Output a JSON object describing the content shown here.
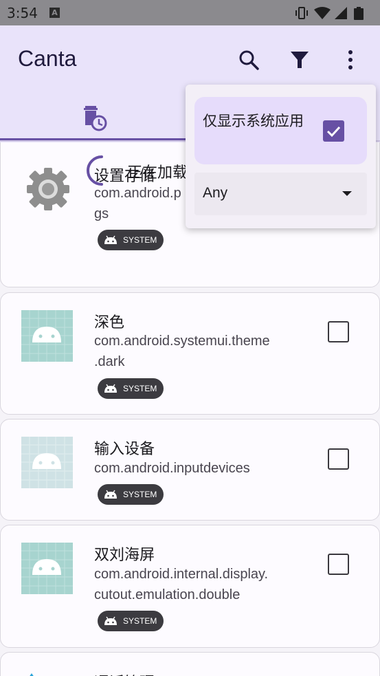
{
  "status_bar": {
    "time": "3:54",
    "notification_letter": "A",
    "icons": [
      "vibrate-icon",
      "wifi-icon",
      "signal-icon",
      "battery-icon"
    ]
  },
  "app_bar": {
    "title": "Canta",
    "actions": [
      "search-icon",
      "filter-icon",
      "more-vert-icon"
    ]
  },
  "tabs": [
    {
      "icon": "delete-schedule-icon",
      "selected": true
    }
  ],
  "loading": {
    "text": "正在加载"
  },
  "apps": [
    {
      "name": "设置存储",
      "package": "com.android.settings",
      "package_visible": "com.android.p\ngs",
      "badge": "SYSTEM",
      "icon": "settings-gear-icon",
      "checked": false
    },
    {
      "name": "深色",
      "package": "com.android.systemui.theme\n.dark",
      "badge": "SYSTEM",
      "icon": "android-icon",
      "checked": false
    },
    {
      "name": "输入设备",
      "package": "com.android.inputdevices",
      "badge": "SYSTEM",
      "icon": "android-icon",
      "checked": false
    },
    {
      "name": "双刘海屏",
      "package": "com.android.internal.display.\ncutout.emulation.double",
      "badge": "SYSTEM",
      "icon": "android-icon",
      "checked": false
    },
    {
      "name": "通话管理",
      "icon": "call-management-icon"
    }
  ],
  "filter_menu": {
    "show_system_label": "仅显示系统应用",
    "show_system_checked": true,
    "type_value": "Any"
  },
  "colors": {
    "accent": "#6750a4",
    "app_bar": "#e9e3fa",
    "chip": "#3c3b40"
  }
}
